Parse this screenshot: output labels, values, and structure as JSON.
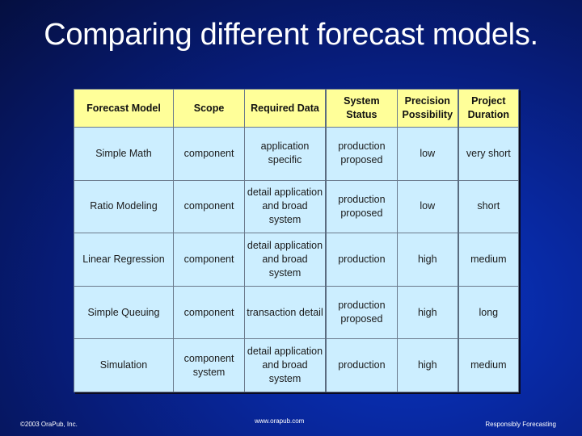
{
  "slide": {
    "title": "Comparing different forecast models."
  },
  "table": {
    "headers": [
      "Forecast Model",
      "Scope",
      "Required Data",
      "System Status",
      "Precision Possibility",
      "Project Duration"
    ],
    "rows": [
      [
        "Simple Math",
        "component",
        "application specific",
        "production proposed",
        "low",
        "very short"
      ],
      [
        "Ratio Modeling",
        "component",
        "detail application and broad system",
        "production proposed",
        "low",
        "short"
      ],
      [
        "Linear Regression",
        "component",
        "detail application and broad system",
        "production",
        "high",
        "medium"
      ],
      [
        "Simple Queuing",
        "component",
        "transaction detail",
        "production proposed",
        "high",
        "long"
      ],
      [
        "Simulation",
        "component system",
        "detail application and broad system",
        "production",
        "high",
        "medium"
      ]
    ]
  },
  "footer": {
    "copyright": "©2003 OraPub, Inc.",
    "website": "www.orapub.com",
    "tagline": "Responsibly Forecasting"
  },
  "colors": {
    "header_bg": "#ffff99",
    "cell_bg": "#cceeff",
    "background": "#0828a0"
  }
}
